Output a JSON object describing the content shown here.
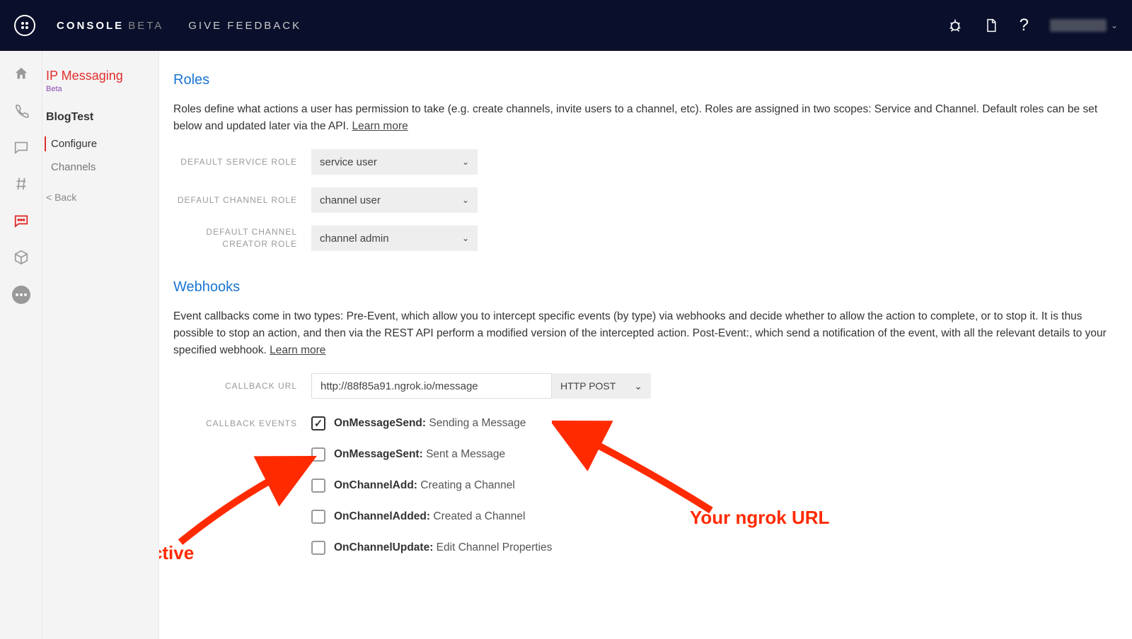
{
  "header": {
    "brand": "CONSOLE",
    "brand_beta": "BETA",
    "feedback": "GIVE FEEDBACK"
  },
  "sidebar": {
    "title": "IP Messaging",
    "beta": "Beta",
    "service": "BlogTest",
    "items": [
      "Configure",
      "Channels"
    ],
    "back": "< Back"
  },
  "roles": {
    "title": "Roles",
    "desc_a": "Roles define what actions a user has permission to take (e.g. create channels, invite users to a channel, etc). Roles are assigned in two scopes: Service and Channel. Default roles can be set below and updated later via the API. ",
    "learn": "Learn more",
    "fields": [
      {
        "label": "DEFAULT SERVICE ROLE",
        "value": "service user"
      },
      {
        "label": "DEFAULT CHANNEL ROLE",
        "value": "channel user"
      },
      {
        "label": "DEFAULT CHANNEL CREATOR ROLE",
        "value": "channel admin"
      }
    ]
  },
  "webhooks": {
    "title": "Webhooks",
    "desc_a": "Event callbacks come in two types: Pre-Event, which allow you to intercept specific events (by type) via webhooks and decide whether to allow the action to complete, or to stop it. It is thus possible to stop an action, and then via the REST API perform a modified version of the intercepted action. Post-Event:, which send a notification of the event, with all the relevant details to your specified webhook. ",
    "learn": "Learn more",
    "callback_label": "CALLBACK URL",
    "callback_value": "http://88f85a91.ngrok.io/message",
    "method": "HTTP POST",
    "events_label": "CALLBACK EVENTS",
    "events": [
      {
        "name": "OnMessageSend:",
        "desc": " Sending a Message",
        "checked": true
      },
      {
        "name": "OnMessageSent:",
        "desc": " Sent a Message",
        "checked": false
      },
      {
        "name": "OnChannelAdd:",
        "desc": " Creating a Channel",
        "checked": false
      },
      {
        "name": "OnChannelAdded:",
        "desc": " Created a Channel",
        "checked": false
      },
      {
        "name": "OnChannelUpdate:",
        "desc": " Edit Channel Properties",
        "checked": false
      }
    ]
  },
  "annotations": {
    "must_active": "Must be active",
    "ngrok": "Your ngrok URL"
  }
}
